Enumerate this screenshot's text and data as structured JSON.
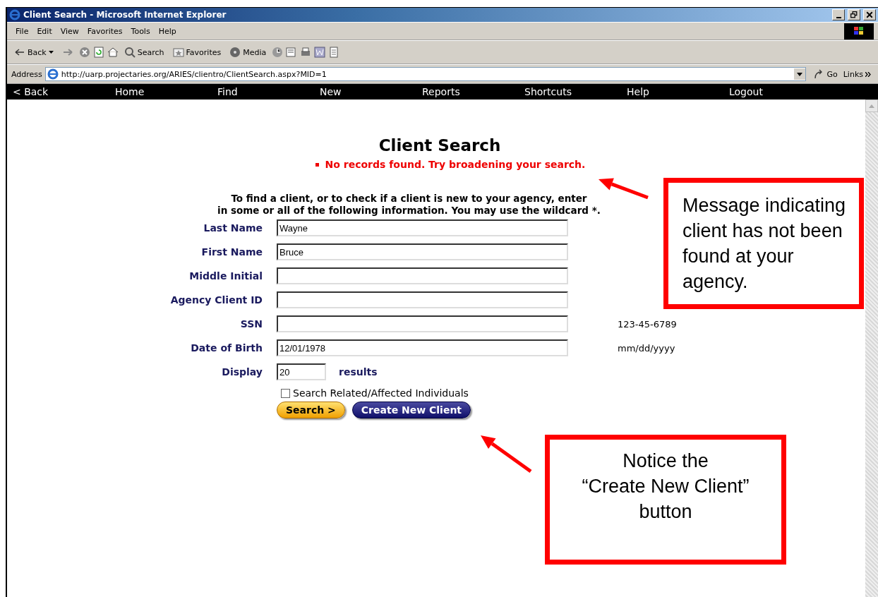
{
  "window": {
    "title": "Client Search - Microsoft Internet Explorer"
  },
  "menu_bar": [
    "File",
    "Edit",
    "View",
    "Favorites",
    "Tools",
    "Help"
  ],
  "toolbar": {
    "back": "Back",
    "search": "Search",
    "favorites": "Favorites",
    "media": "Media"
  },
  "address_bar": {
    "label": "Address",
    "url": "http://uarp.projectaries.org/ARIES/clientro/ClientSearch.aspx?MID=1",
    "go": "Go",
    "links": "Links"
  },
  "nav": [
    "< Back",
    "Home",
    "Find",
    "New",
    "Reports",
    "Shortcuts",
    "Help",
    "Logout"
  ],
  "page": {
    "title": "Client Search",
    "message": "No records found. Try broadening your search.",
    "instructions": [
      "To find a client, or to check if a client is new to your agency, enter",
      "in some or all of the following information. You may use the wildcard *."
    ],
    "fields": [
      {
        "label": "Last Name",
        "value": "Wayne"
      },
      {
        "label": "First Name",
        "value": "Bruce"
      },
      {
        "label": "Middle Initial"
      },
      {
        "label": "Agency Client ID"
      },
      {
        "label": "SSN",
        "hint": "123-45-6789"
      },
      {
        "label": "Date of Birth",
        "value": "12/01/1978",
        "hint": "mm/dd/yyyy"
      }
    ],
    "display": {
      "label": "Display",
      "value": "20",
      "suffix": "results"
    },
    "checkbox": {
      "label": "Search Related/Affected Individuals",
      "checked": false
    },
    "buttons": [
      {
        "label": "Search >",
        "kind": "primary"
      },
      {
        "label": "Create New Client",
        "kind": "secondary"
      }
    ]
  },
  "annotations": [
    {
      "lines": [
        "Message indicating",
        "client has not been",
        "found at your",
        "agency."
      ]
    },
    {
      "lines": [
        "Notice the",
        "“Create New Client”",
        "button"
      ]
    }
  ]
}
